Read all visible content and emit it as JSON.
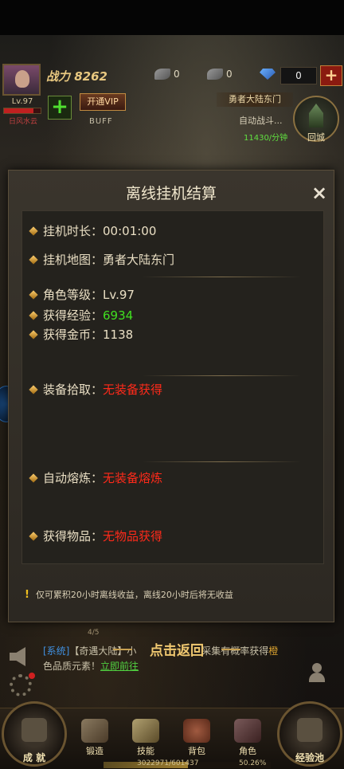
{
  "header": {
    "power": "战力 8262",
    "level": "Lv.97",
    "hp_fraction": 0.8,
    "guild": "日风水云",
    "feather_count": "0",
    "stone_count": "0",
    "gem_count": "0",
    "vip_label": "开通VIP",
    "buff_label": "BUFF",
    "map_name": "勇者大陆东门",
    "auto_fight": "自动战斗...",
    "exp_rate": "11430/分钟",
    "back_city": "回城"
  },
  "dialog": {
    "title": "离线挂机结算",
    "close_icon": "×",
    "rows": {
      "duration_label": "挂机时长：",
      "duration_value": "00:01:00",
      "map_label": "挂机地图：",
      "map_value": "勇者大陆东门",
      "level_label": "角色等级：",
      "level_value": "Lv.97",
      "exp_label": "获得经验：",
      "exp_value": "6934",
      "gold_label": "获得金币：",
      "gold_value": "1138",
      "equip_label": "装备拾取：",
      "equip_value": "无装备获得",
      "smelt_label": "自动熔炼：",
      "smelt_value": "无装备熔炼",
      "items_label": "获得物品：",
      "items_value": "无物品获得"
    },
    "note": "仅可累积20小时离线收益，离线20小时后将无收益",
    "colors": {
      "green": "#40e020",
      "red": "#ff2a1a"
    }
  },
  "chat": {
    "page": "4/5",
    "system_tag": "[系统]",
    "message_1": "【奇遇大陆】小",
    "message_2": "采集有概率获得",
    "gold_text": "橙",
    "message_3": "色品质元素！",
    "link": "立即前往"
  },
  "click_back": "点击返回",
  "bottom": {
    "achievement": "成 就",
    "forge": "锻造",
    "skill": "技能",
    "bag": "背包",
    "role": "角色",
    "exp_pool": "经验池",
    "exp_text": "3022971/601437",
    "exp_percent": "50.26%",
    "exp_fraction": 0.5026
  }
}
